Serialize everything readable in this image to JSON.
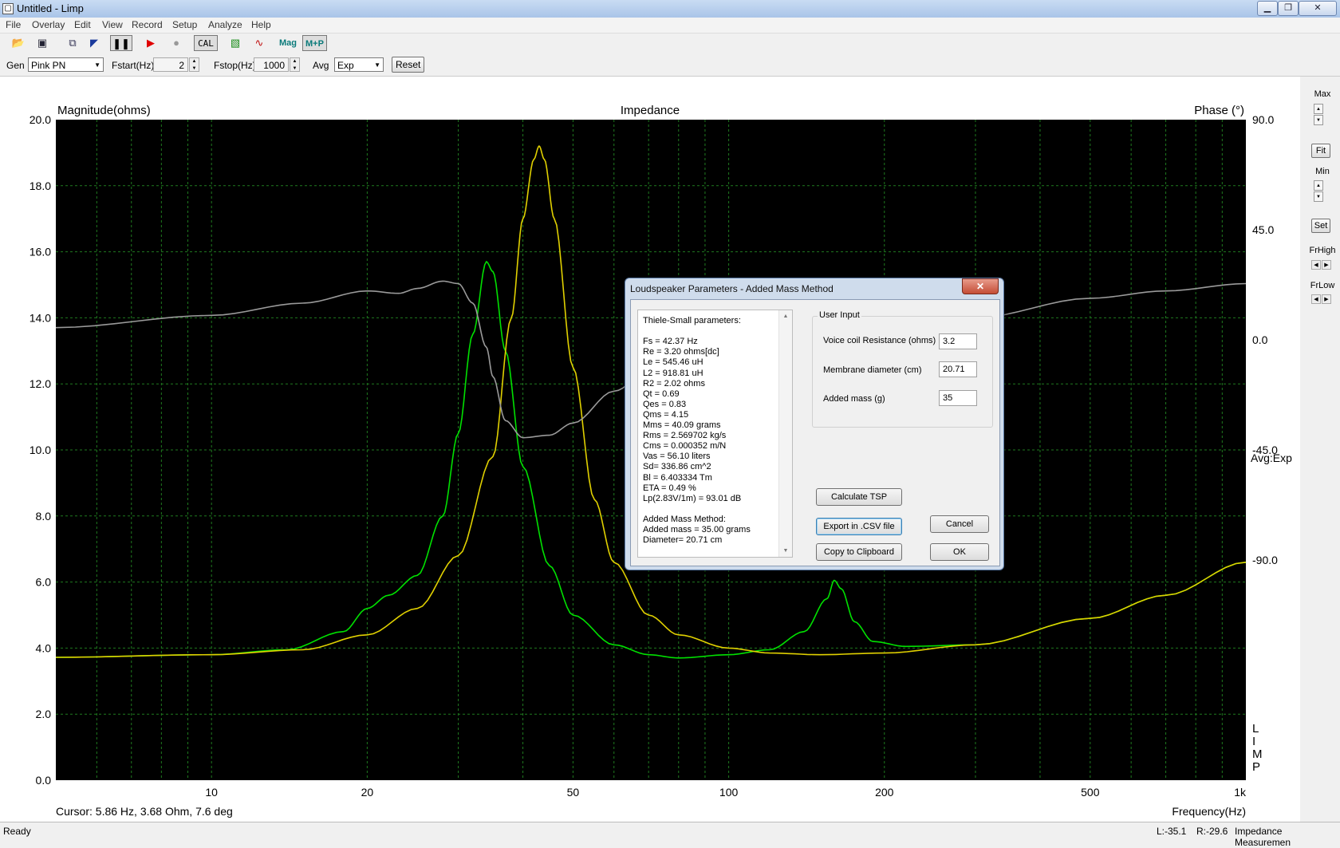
{
  "window": {
    "title": "Untitled - Limp",
    "app_icon": "limp-app-icon",
    "buttons": [
      "minimize",
      "maximize",
      "close"
    ]
  },
  "menu": [
    "File",
    "Overlay",
    "Edit",
    "View",
    "Record",
    "Setup",
    "Analyze",
    "Help"
  ],
  "toolbar": {
    "cal_label": "CAL",
    "mag_label": "Mag",
    "mp_label": "M+P",
    "icons": [
      "open-folder-icon",
      "save-disk-icon",
      "copy-overlay-icon",
      "pen-icon",
      "pause-icon",
      "play-icon",
      "record-icon",
      "cal-icon",
      "filter-icon",
      "waveform-icon"
    ]
  },
  "genbar": {
    "gen_label": "Gen",
    "gen_value": "Pink PN",
    "fstart_label": "Fstart(Hz)",
    "fstart_value": "2",
    "fstop_label": "Fstop(Hz)",
    "fstop_value": "1000",
    "avg_label": "Avg",
    "avg_value": "Exp",
    "reset_label": "Reset"
  },
  "plot": {
    "left_title": "Magnitude(ohms)",
    "center_title": "Impedance",
    "right_title": "Phase (°)",
    "avg_label": "Avg:Exp",
    "logo": "LIMP",
    "xlabel": "Frequency(Hz)",
    "cursor_text": "Cursor: 5.86 Hz, 3.68 Ohm, 7.6 deg",
    "colors": {
      "background": "#000000",
      "grid": "#1f7a1f",
      "series1": "#00e000",
      "series2": "#e0d000",
      "phase": "#9a9a9a"
    }
  },
  "chart_data": {
    "type": "line",
    "title": "Impedance",
    "xlabel": "Frequency(Hz)",
    "ylabel": "Magnitude(ohms)",
    "y2label": "Phase (°)",
    "xscale": "log",
    "xlim": [
      5,
      1000
    ],
    "ylim": [
      0,
      20
    ],
    "y2lim": [
      -180,
      90
    ],
    "xticks": [
      {
        "v": 10,
        "t": "10"
      },
      {
        "v": 20,
        "t": "20"
      },
      {
        "v": 50,
        "t": "50"
      },
      {
        "v": 100,
        "t": "100"
      },
      {
        "v": 200,
        "t": "200"
      },
      {
        "v": 500,
        "t": "500"
      },
      {
        "v": 1000,
        "t": "1k"
      }
    ],
    "yticks": [
      "0.0",
      "2.0",
      "4.0",
      "6.0",
      "8.0",
      "10.0",
      "12.0",
      "14.0",
      "16.0",
      "18.0",
      "20.0"
    ],
    "y2ticks": [
      {
        "v": 90,
        "t": "90.0"
      },
      {
        "v": 45,
        "t": "45.0"
      },
      {
        "v": 0,
        "t": "0.0"
      },
      {
        "v": -45,
        "t": "-45.0"
      },
      {
        "v": -90,
        "t": "-90.0"
      }
    ],
    "grid": true,
    "series": [
      {
        "axis": "y",
        "color": "#00e000",
        "points": [
          [
            5,
            3.72
          ],
          [
            10,
            3.8
          ],
          [
            14,
            3.95
          ],
          [
            18,
            4.5
          ],
          [
            20,
            5.2
          ],
          [
            22,
            5.6
          ],
          [
            25,
            6.2
          ],
          [
            28,
            8.0
          ],
          [
            30,
            10.5
          ],
          [
            32,
            13.5
          ],
          [
            34,
            15.7
          ],
          [
            35,
            15.4
          ],
          [
            37,
            13
          ],
          [
            40,
            9.5
          ],
          [
            45,
            6.5
          ],
          [
            50,
            5.0
          ],
          [
            60,
            4.1
          ],
          [
            70,
            3.8
          ],
          [
            80,
            3.7
          ],
          [
            100,
            3.8
          ],
          [
            120,
            3.95
          ],
          [
            140,
            4.5
          ],
          [
            155,
            5.5
          ],
          [
            160,
            6.05
          ],
          [
            165,
            5.8
          ],
          [
            175,
            4.8
          ],
          [
            190,
            4.2
          ],
          [
            220,
            4.05
          ],
          [
            300,
            4.1
          ],
          [
            500,
            4.9
          ],
          [
            700,
            5.6
          ],
          [
            1000,
            6.6
          ]
        ]
      },
      {
        "axis": "y",
        "color": "#e0d000",
        "points": [
          [
            5,
            3.72
          ],
          [
            10,
            3.8
          ],
          [
            15,
            3.95
          ],
          [
            20,
            4.4
          ],
          [
            25,
            5.2
          ],
          [
            30,
            6.8
          ],
          [
            35,
            9.8
          ],
          [
            38,
            14
          ],
          [
            40,
            17
          ],
          [
            42,
            18.8
          ],
          [
            43,
            19.2
          ],
          [
            44,
            18.8
          ],
          [
            46,
            17
          ],
          [
            50,
            12.5
          ],
          [
            55,
            8.5
          ],
          [
            60,
            6.6
          ],
          [
            70,
            5.0
          ],
          [
            80,
            4.4
          ],
          [
            100,
            4.0
          ],
          [
            120,
            3.85
          ],
          [
            150,
            3.8
          ],
          [
            200,
            3.85
          ],
          [
            300,
            4.1
          ],
          [
            500,
            4.9
          ],
          [
            700,
            5.6
          ],
          [
            1000,
            6.6
          ]
        ]
      },
      {
        "axis": "y2",
        "color": "#9a9a9a",
        "points": [
          [
            5,
            5
          ],
          [
            10,
            10
          ],
          [
            15,
            15
          ],
          [
            20,
            20
          ],
          [
            23,
            19
          ],
          [
            25,
            21
          ],
          [
            28,
            24
          ],
          [
            30,
            23
          ],
          [
            32,
            15
          ],
          [
            34,
            -3
          ],
          [
            35,
            -15
          ],
          [
            37,
            -33
          ],
          [
            40,
            -40
          ],
          [
            45,
            -39
          ],
          [
            50,
            -34
          ],
          [
            60,
            -21
          ],
          [
            70,
            -13
          ],
          [
            80,
            -7
          ],
          [
            100,
            -1
          ],
          [
            130,
            7
          ],
          [
            150,
            11
          ],
          [
            160,
            10
          ],
          [
            170,
            3
          ],
          [
            180,
            -4
          ],
          [
            190,
            -5
          ],
          [
            200,
            -3
          ],
          [
            220,
            1
          ],
          [
            300,
            9
          ],
          [
            500,
            17
          ],
          [
            700,
            20
          ],
          [
            1000,
            23
          ]
        ]
      }
    ]
  },
  "right_panel": {
    "max_label": "Max",
    "fit_label": "Fit",
    "min_label": "Min",
    "set_label": "Set",
    "frhigh_label": "FrHigh",
    "frlow_label": "FrLow"
  },
  "status": {
    "left": "Ready",
    "l_value": "L:-35.1",
    "r_value": "R:-29.6",
    "mode": "Impedance Measuremen"
  },
  "dialog": {
    "title": "Loudspeaker Parameters - Added Mass Method",
    "close_label": "✕",
    "tsp_lines": [
      "Thiele-Small parameters:",
      "",
      "Fs  = 42.37 Hz",
      "Re  = 3.20 ohms[dc]",
      "Le  = 545.46 uH",
      "L2  = 918.81 uH",
      "R2  = 2.02 ohms",
      "Qt  = 0.69",
      "Qes = 0.83",
      "Qms = 4.15",
      "Mms = 40.09 grams",
      "Rms = 2.569702 kg/s",
      "Cms = 0.000352 m/N",
      "Vas = 56.10 liters",
      "Sd= 336.86 cm^2",
      "Bl  = 6.403334 Tm",
      "ETA = 0.49 %",
      "Lp(2.83V/1m) = 93.01 dB",
      "",
      "Added Mass Method:",
      "Added mass = 35.00 grams",
      "Diameter= 20.71 cm"
    ],
    "user_input_label": "User Input",
    "vc_label": "Voice coil Resistance (ohms)",
    "vc_value": "3.2",
    "md_label": "Membrane diameter (cm)",
    "md_value": "20.71",
    "am_label": "Added mass (g)",
    "am_value": "35",
    "calc_label": "Calculate TSP",
    "export_label": "Export in .CSV file",
    "copy_label": "Copy to Clipboard",
    "cancel_label": "Cancel",
    "ok_label": "OK"
  }
}
